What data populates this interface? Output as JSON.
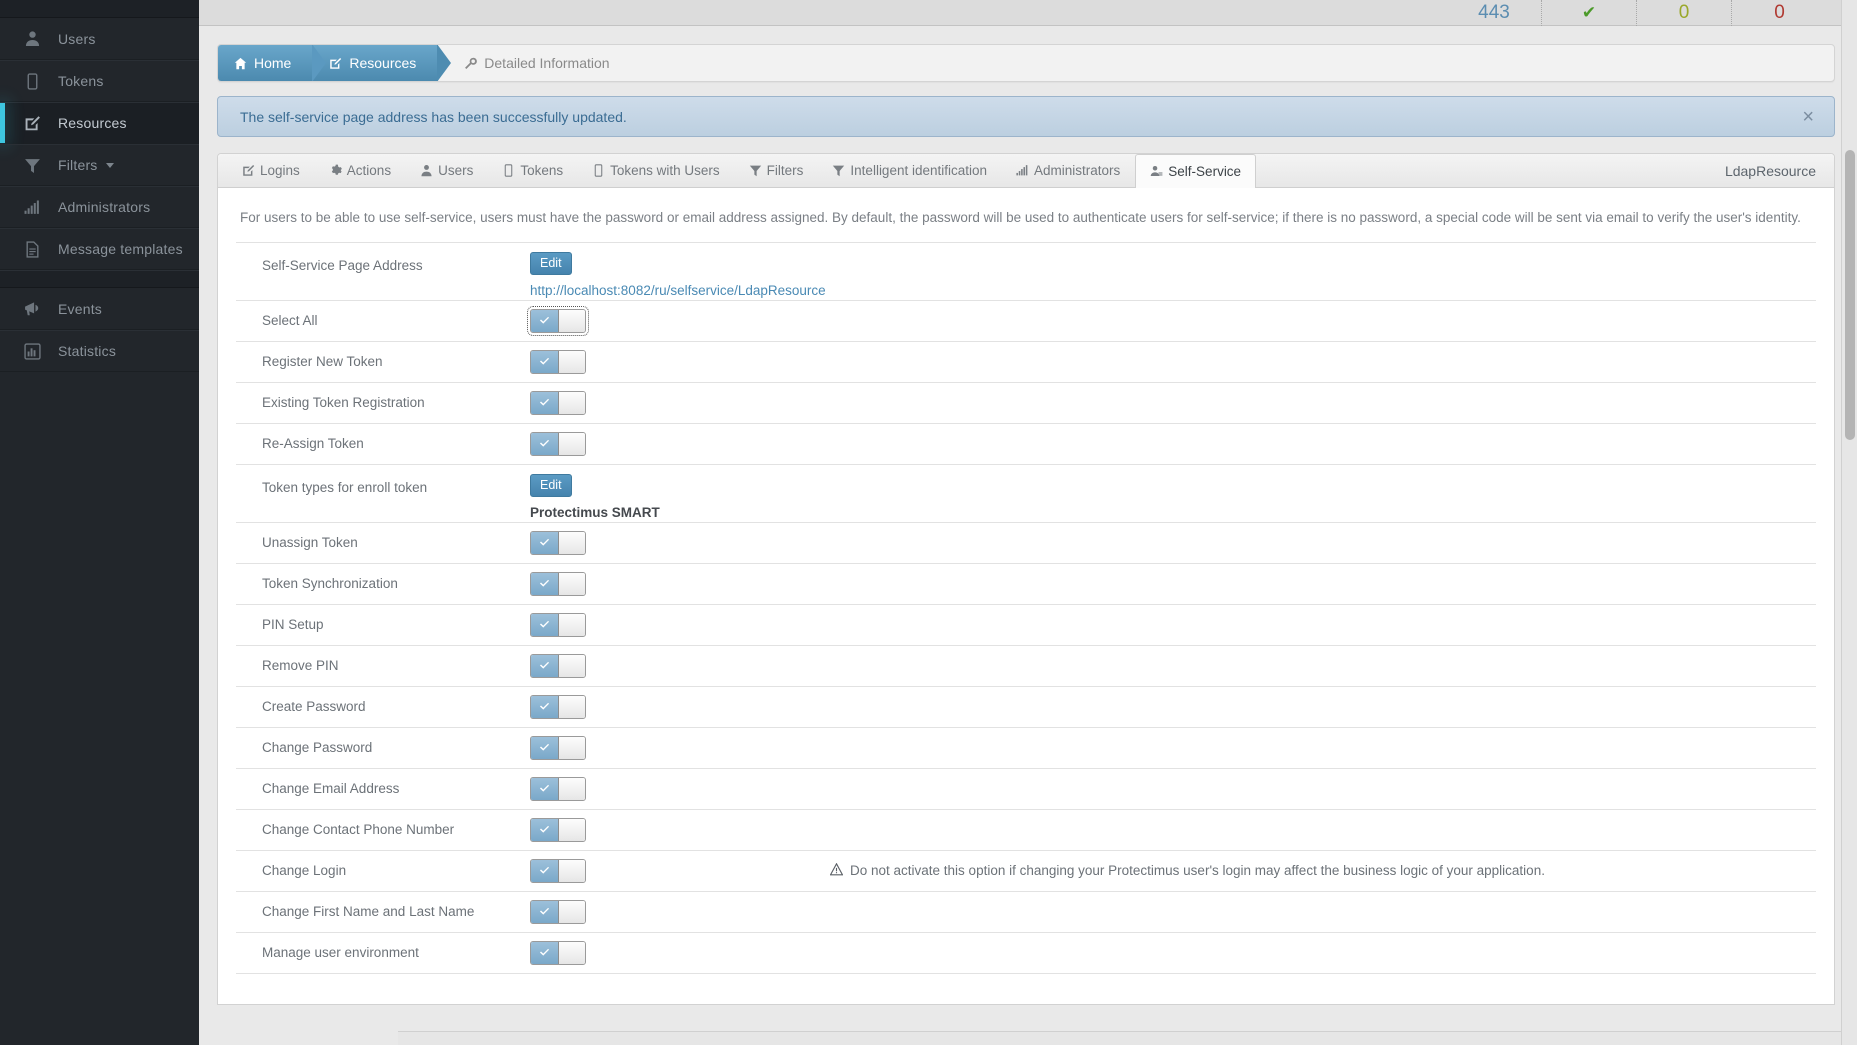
{
  "topbar": {
    "counters": [
      {
        "value": "443",
        "kind": "blue",
        "name": "count-total"
      },
      {
        "value": "✔",
        "kind": "green",
        "name": "status-ok-check"
      },
      {
        "value": "0",
        "kind": "olive",
        "name": "count-warning"
      },
      {
        "value": "0",
        "kind": "red",
        "name": "count-error"
      }
    ]
  },
  "sidebar": {
    "items": [
      {
        "label": "Users",
        "icon": "user-icon",
        "active": false,
        "caret": false
      },
      {
        "label": "Tokens",
        "icon": "token-icon",
        "active": false,
        "caret": false
      },
      {
        "label": "Resources",
        "icon": "resources-edit-icon",
        "active": true,
        "caret": false
      },
      {
        "label": "Filters",
        "icon": "filter-icon",
        "active": false,
        "caret": true
      },
      {
        "label": "Administrators",
        "icon": "bars-icon",
        "active": false,
        "caret": false
      },
      {
        "label": "Message templates",
        "icon": "document-icon",
        "active": false,
        "caret": false
      }
    ],
    "items2": [
      {
        "label": "Events",
        "icon": "megaphone-icon",
        "active": false,
        "caret": false
      },
      {
        "label": "Statistics",
        "icon": "chart-icon",
        "active": false,
        "caret": false
      }
    ]
  },
  "breadcrumb": {
    "items": [
      {
        "label": "Home",
        "icon": "home-icon",
        "style": "on first"
      },
      {
        "label": "Resources",
        "icon": "edit-icon",
        "style": "on"
      },
      {
        "label": "Detailed Information",
        "icon": "wrench-icon",
        "style": "plain"
      }
    ]
  },
  "alert": {
    "message": "The self-service page address has been successfully updated.",
    "close_label": "×"
  },
  "tabs": {
    "items": [
      {
        "label": "Logins",
        "icon": "edit-icon",
        "active": false
      },
      {
        "label": "Actions",
        "icon": "gear-icon",
        "active": false
      },
      {
        "label": "Users",
        "icon": "user-icon",
        "active": false
      },
      {
        "label": "Tokens",
        "icon": "token-icon",
        "active": false
      },
      {
        "label": "Tokens with Users",
        "icon": "token-icon",
        "active": false
      },
      {
        "label": "Filters",
        "icon": "filter-icon",
        "active": false
      },
      {
        "label": "Intelligent identification",
        "icon": "filter-icon",
        "active": false
      },
      {
        "label": "Administrators",
        "icon": "bars-icon",
        "active": false
      },
      {
        "label": "Self-Service",
        "icon": "self-service-icon",
        "active": true
      }
    ],
    "right_label": "LdapResource"
  },
  "panel": {
    "description": "For users to be able to use self-service, users must have the password or email address assigned. By default, the password will be used to authenticate users for self-service; if there is no password, a special code will be sent via email to verify the user's identity.",
    "rows": [
      {
        "label": "Self-Service Page Address",
        "type": "edit-link",
        "button": "Edit",
        "value": "http://localhost:8082/ru/selfservice/LdapResource",
        "name": "row-self-service-page-address"
      },
      {
        "label": "Select All",
        "type": "switch",
        "on": true,
        "focused": true,
        "name": "row-select-all"
      },
      {
        "label": "Register New Token",
        "type": "switch",
        "on": true,
        "focused": false,
        "name": "row-register-new-token"
      },
      {
        "label": "Existing Token Registration",
        "type": "switch",
        "on": true,
        "focused": false,
        "name": "row-existing-token-registration"
      },
      {
        "label": "Re-Assign Token",
        "type": "switch",
        "on": true,
        "focused": false,
        "name": "row-re-assign-token"
      },
      {
        "label": "Token types for enroll token",
        "type": "edit-value",
        "button": "Edit",
        "value": "Protectimus SMART",
        "name": "row-token-types-for-enroll-token"
      },
      {
        "label": "Unassign Token",
        "type": "switch",
        "on": true,
        "focused": false,
        "name": "row-unassign-token"
      },
      {
        "label": "Token Synchronization",
        "type": "switch",
        "on": true,
        "focused": false,
        "name": "row-token-synchronization"
      },
      {
        "label": "PIN Setup",
        "type": "switch",
        "on": true,
        "focused": false,
        "name": "row-pin-setup"
      },
      {
        "label": "Remove PIN",
        "type": "switch",
        "on": true,
        "focused": false,
        "name": "row-remove-pin"
      },
      {
        "label": "Create Password",
        "type": "switch",
        "on": true,
        "focused": false,
        "name": "row-create-password"
      },
      {
        "label": "Change Password",
        "type": "switch",
        "on": true,
        "focused": false,
        "name": "row-change-password"
      },
      {
        "label": "Change Email Address",
        "type": "switch",
        "on": true,
        "focused": false,
        "name": "row-change-email-address"
      },
      {
        "label": "Change Contact Phone Number",
        "type": "switch",
        "on": true,
        "focused": false,
        "name": "row-change-contact-phone-number"
      },
      {
        "label": "Change Login",
        "type": "switch",
        "on": true,
        "focused": false,
        "warning": "Do not activate this option if changing your Protectimus user's login may affect the business logic of your application.",
        "name": "row-change-login"
      },
      {
        "label": "Change First Name and Last Name",
        "type": "switch",
        "on": true,
        "focused": false,
        "name": "row-change-first-name-and-last-name"
      },
      {
        "label": "Manage user environment",
        "type": "switch",
        "on": true,
        "focused": false,
        "name": "row-manage-user-environment"
      }
    ]
  }
}
